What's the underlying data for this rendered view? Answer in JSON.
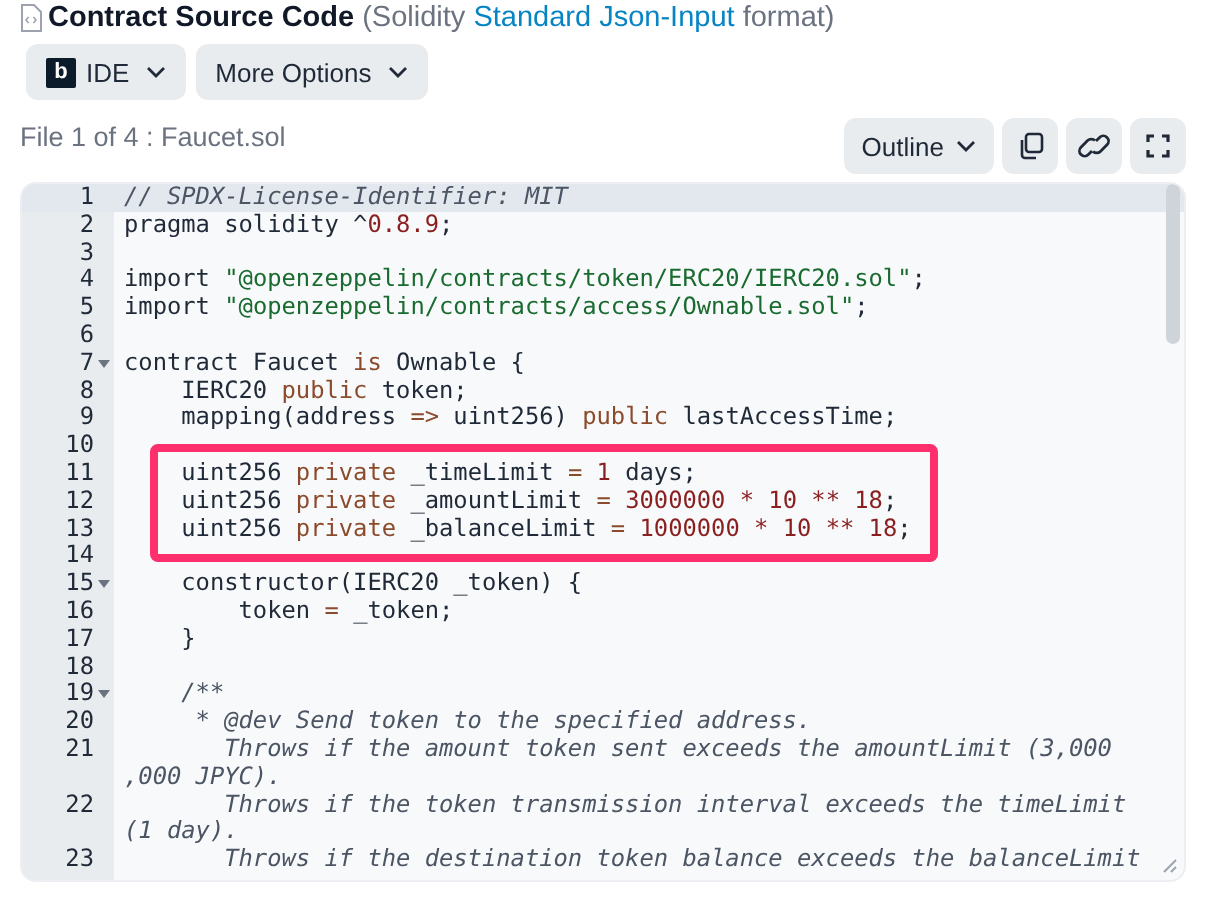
{
  "header": {
    "title": "Contract Source Code",
    "note_prefix": "(Solidity",
    "note_link": "Standard Json-Input",
    "note_suffix": "format)"
  },
  "toolbar": [
    {
      "label": "IDE",
      "kind": "logo"
    },
    {
      "label": "More Options",
      "kind": "plain"
    }
  ],
  "logo_letter": "b",
  "file_label": "File 1 of 4 : Faucet.sol",
  "outline": {
    "label": "Outline"
  },
  "code": {
    "lines": [
      {
        "number": "1",
        "active": true,
        "foldable": false,
        "highlighted": false,
        "tokens": [
          {
            "kind": "comment",
            "text": "// SPDX-License-Identifier: MIT"
          }
        ]
      },
      {
        "number": "2",
        "active": false,
        "foldable": false,
        "highlighted": false,
        "tokens": [
          {
            "kind": "plain",
            "text": "pragma solidity ^"
          },
          {
            "kind": "number",
            "text": "0.8.9"
          },
          {
            "kind": "plain",
            "text": ";"
          }
        ]
      },
      {
        "number": "3",
        "active": false,
        "foldable": false,
        "highlighted": false
      },
      {
        "number": "4",
        "active": false,
        "foldable": false,
        "highlighted": false,
        "tokens": [
          {
            "kind": "plain",
            "text": "import "
          },
          {
            "kind": "string",
            "text": "\"@openzeppelin/contracts/token/ERC20/IERC20.sol\""
          },
          {
            "kind": "plain",
            "text": ";"
          }
        ]
      },
      {
        "number": "5",
        "active": false,
        "foldable": false,
        "highlighted": false,
        "tokens": [
          {
            "kind": "plain",
            "text": "import "
          },
          {
            "kind": "string",
            "text": "\"@openzeppelin/contracts/access/Ownable.sol\""
          },
          {
            "kind": "plain",
            "text": ";"
          }
        ]
      },
      {
        "number": "6",
        "active": false,
        "foldable": false,
        "highlighted": false
      },
      {
        "number": "7",
        "active": false,
        "foldable": true,
        "highlighted": false,
        "tokens": [
          {
            "kind": "plain",
            "text": "contract Faucet "
          },
          {
            "kind": "keyword",
            "text": "is"
          },
          {
            "kind": "plain",
            "text": " Ownable {"
          }
        ]
      },
      {
        "number": "8",
        "active": false,
        "foldable": false,
        "highlighted": false,
        "tokens": [
          {
            "kind": "plain",
            "text": "    IERC20 "
          },
          {
            "kind": "keyword",
            "text": "public"
          },
          {
            "kind": "plain",
            "text": " token;"
          }
        ]
      },
      {
        "number": "9",
        "active": false,
        "foldable": false,
        "highlighted": false,
        "tokens": [
          {
            "kind": "plain",
            "text": "    mapping(address "
          },
          {
            "kind": "keyword",
            "text": "=>"
          },
          {
            "kind": "plain",
            "text": " uint256) "
          },
          {
            "kind": "keyword",
            "text": "public"
          },
          {
            "kind": "plain",
            "text": " lastAccessTime;"
          }
        ]
      },
      {
        "number": "10",
        "active": false,
        "foldable": false,
        "highlighted": false
      },
      {
        "number": "11",
        "active": false,
        "foldable": false,
        "highlighted": true,
        "tokens": [
          {
            "kind": "plain",
            "text": "    uint256 "
          },
          {
            "kind": "keyword",
            "text": "private"
          },
          {
            "kind": "plain",
            "text": " _timeLimit "
          },
          {
            "kind": "keyword",
            "text": "= "
          },
          {
            "kind": "number",
            "text": "1"
          },
          {
            "kind": "plain",
            "text": " days;"
          }
        ]
      },
      {
        "number": "12",
        "active": false,
        "foldable": false,
        "highlighted": true,
        "tokens": [
          {
            "kind": "plain",
            "text": "    uint256 "
          },
          {
            "kind": "keyword",
            "text": "private"
          },
          {
            "kind": "plain",
            "text": " _amountLimit "
          },
          {
            "kind": "keyword",
            "text": "= "
          },
          {
            "kind": "number",
            "text": "3000000 * 10 ** 18"
          },
          {
            "kind": "plain",
            "text": ";"
          }
        ]
      },
      {
        "number": "13",
        "active": false,
        "foldable": false,
        "highlighted": true,
        "tokens": [
          {
            "kind": "plain",
            "text": "    uint256 "
          },
          {
            "kind": "keyword",
            "text": "private"
          },
          {
            "kind": "plain",
            "text": " _balanceLimit "
          },
          {
            "kind": "keyword",
            "text": "= "
          },
          {
            "kind": "number",
            "text": "1000000 * 10 ** 18"
          },
          {
            "kind": "plain",
            "text": ";"
          }
        ]
      },
      {
        "number": "14",
        "active": false,
        "foldable": false,
        "highlighted": false
      },
      {
        "number": "15",
        "active": false,
        "foldable": true,
        "highlighted": false,
        "tokens": [
          {
            "kind": "plain",
            "text": "    constructor(IERC20 _token) {"
          }
        ]
      },
      {
        "number": "16",
        "active": false,
        "foldable": false,
        "highlighted": false,
        "tokens": [
          {
            "kind": "plain",
            "text": "        token "
          },
          {
            "kind": "keyword",
            "text": "="
          },
          {
            "kind": "plain",
            "text": " _token;"
          }
        ]
      },
      {
        "number": "17",
        "active": false,
        "foldable": false,
        "highlighted": false,
        "tokens": [
          {
            "kind": "plain",
            "text": "    }"
          }
        ]
      },
      {
        "number": "18",
        "active": false,
        "foldable": false,
        "highlighted": false
      },
      {
        "number": "19",
        "active": false,
        "foldable": true,
        "highlighted": false,
        "tokens": [
          {
            "kind": "comment",
            "text": "    /**"
          }
        ]
      },
      {
        "number": "20",
        "active": false,
        "foldable": false,
        "highlighted": false,
        "tokens": [
          {
            "kind": "comment",
            "text": "     * @dev Send token to the specified address."
          }
        ]
      },
      {
        "number": "21",
        "active": false,
        "foldable": false,
        "highlighted": false,
        "tokens": [
          {
            "kind": "comment",
            "text": "       Throws if the amount token sent exceeds the amountLimit (3,000"
          }
        ],
        "continuation": ",000 JPYC)."
      },
      {
        "number": "22",
        "active": false,
        "foldable": false,
        "highlighted": false,
        "tokens": [
          {
            "kind": "comment",
            "text": "       Throws if the token transmission interval exceeds the timeLimit"
          }
        ],
        "continuation": "(1 day)."
      },
      {
        "number": "23",
        "active": false,
        "foldable": false,
        "highlighted": false,
        "tokens": [
          {
            "kind": "comment",
            "text": "       Throws if the destination token balance exceeds the balanceLimit"
          }
        ]
      }
    ]
  }
}
